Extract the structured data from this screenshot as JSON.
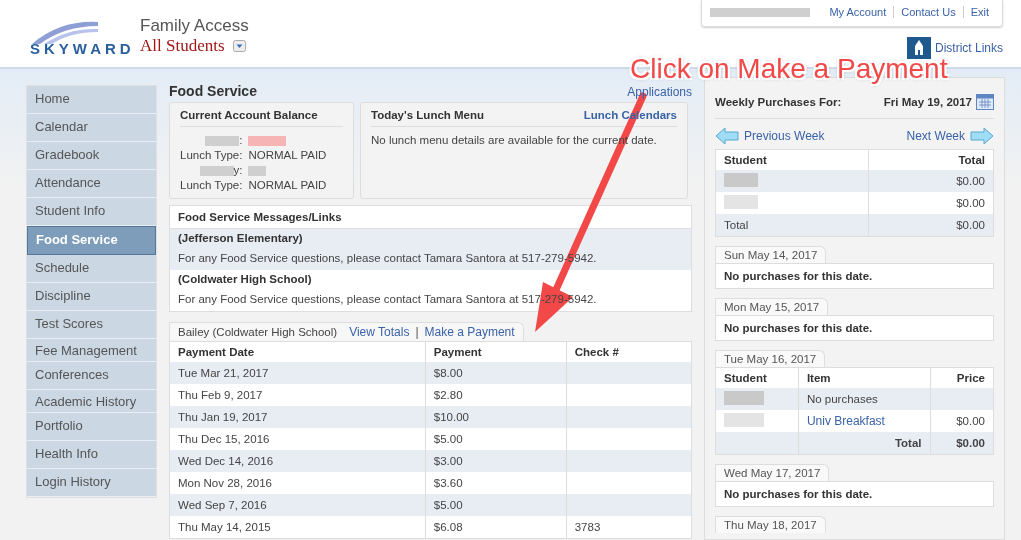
{
  "header": {
    "logo": "SKYWARD",
    "app_title": "Family Access",
    "student_selector": "All Students",
    "top_links": [
      "My Account",
      "Contact Us",
      "Exit"
    ],
    "district_links": "District Links"
  },
  "sidebar": {
    "items": [
      {
        "label": "Home",
        "selected": false
      },
      {
        "label": "Calendar",
        "selected": false
      },
      {
        "label": "Gradebook",
        "selected": false
      },
      {
        "label": "Attendance",
        "selected": false
      },
      {
        "label": "Student Info",
        "selected": false
      },
      {
        "label": "Food Service",
        "selected": true
      },
      {
        "label": "Schedule",
        "selected": false
      },
      {
        "label": "Discipline",
        "selected": false
      },
      {
        "label": "Test Scores",
        "selected": false
      },
      {
        "label": "Fee Management",
        "selected": false
      },
      {
        "label": "Conferences",
        "selected": false
      },
      {
        "label": "Academic History",
        "selected": false
      },
      {
        "label": "Portfolio",
        "selected": false
      },
      {
        "label": "Health Info",
        "selected": false
      },
      {
        "label": "Login History",
        "selected": false
      }
    ]
  },
  "page_title": "Food Service",
  "applications_link": "Applications",
  "balance": {
    "title": "Current Account Balance",
    "rows": [
      {
        "name_tail": ":",
        "lunch_type_label": "Lunch Type:",
        "lunch_type": "NORMAL PAID",
        "amount_highlight": true
      },
      {
        "name_tail": "y:",
        "lunch_type_label": "Lunch Type:",
        "lunch_type": "NORMAL PAID",
        "amount_highlight": false
      }
    ]
  },
  "lunch_menu": {
    "title": "Today's Lunch Menu",
    "link": "Lunch Calendars",
    "message": "No lunch menu details are available for the current date."
  },
  "messages": {
    "title": "Food Service Messages/Links",
    "schools": [
      {
        "school": "(Jefferson Elementary)",
        "message": "For any Food Service questions, please contact Tamara Santora at 517-279-5942."
      },
      {
        "school": "(Coldwater High School)",
        "message": "For any Food Service questions, please contact Tamara Santora at 517-279-5942."
      }
    ]
  },
  "payments": {
    "student": "Bailey (Coldwater High School)",
    "links": [
      "View Totals",
      "Make a Payment"
    ],
    "separator": "|",
    "columns": [
      "Payment Date",
      "Payment",
      "Check #"
    ],
    "rows": [
      [
        "Tue Mar 21, 2017",
        "$8.00",
        ""
      ],
      [
        "Thu Feb 9, 2017",
        "$2.80",
        ""
      ],
      [
        "Thu Jan 19, 2017",
        "$10.00",
        ""
      ],
      [
        "Thu Dec 15, 2016",
        "$5.00",
        ""
      ],
      [
        "Wed Dec 14, 2016",
        "$3.00",
        ""
      ],
      [
        "Mon Nov 28, 2016",
        "$3.60",
        ""
      ],
      [
        "Wed Sep 7, 2016",
        "$5.00",
        ""
      ],
      [
        "Thu May 14, 2015",
        "$6.08",
        "3783"
      ]
    ]
  },
  "weekly": {
    "label": "Weekly Purchases For:",
    "date": "Fri May 19, 2017",
    "previous": "Previous Week",
    "next": "Next Week",
    "columns": [
      "Student",
      "Total"
    ],
    "rows": [
      {
        "total": "$0.00"
      },
      {
        "total": "$0.00"
      }
    ],
    "total_label": "Total",
    "total": "$0.00",
    "days": [
      {
        "date": "Sun May 14, 2017",
        "kind": "empty",
        "message": "No purchases for this date."
      },
      {
        "date": "Mon May 15, 2017",
        "kind": "empty",
        "message": "No purchases for this date."
      },
      {
        "date": "Tue May 16, 2017",
        "kind": "table",
        "columns": [
          "Student",
          "Item",
          "Price"
        ],
        "rows": [
          {
            "item": "No purchases",
            "item_link": false,
            "price": ""
          },
          {
            "item": "Univ Breakfast",
            "item_link": true,
            "price": "$0.00"
          }
        ],
        "total_label": "Total",
        "total": "$0.00"
      },
      {
        "date": "Wed May 17, 2017",
        "kind": "empty",
        "message": "No purchases for this date."
      },
      {
        "date": "Thu May 18, 2017",
        "kind": "none"
      }
    ]
  },
  "annotation": "Click on Make a Payment"
}
